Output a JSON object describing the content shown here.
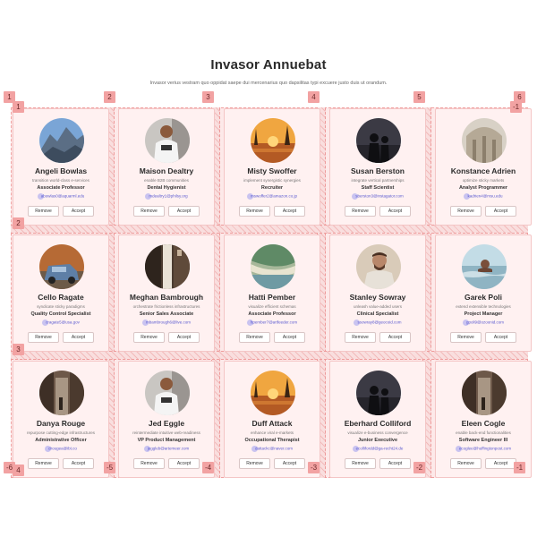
{
  "page": {
    "title": "Invasor Annuebat",
    "subtitle": "Invasor verius vestram quo oppidat saepe dui mercenarius quo dapsilitas typi excuere justo duis ut orandum."
  },
  "buttons": {
    "remove": "Remove",
    "accept": "Accept"
  },
  "colors": {
    "card_bg": "#fff1f1",
    "gutter": "#f9dede",
    "marker": "#f2a2a2",
    "email": "#5a5ad0"
  },
  "markers": {
    "top": [
      "1",
      "2",
      "3",
      "4",
      "5",
      "6"
    ],
    "inner_top_left": "1",
    "inner_top_right": "-1",
    "left": [
      "2",
      "3",
      "4"
    ],
    "bottom": [
      "-6",
      "-5",
      "-4",
      "-3",
      "-2",
      "-1"
    ]
  },
  "cards": [
    {
      "name": "Angeli Bowlas",
      "tagline": "transition world-class e-services",
      "role": "Associate Professor",
      "email": "abowlas0@aquarml.edu",
      "avatar": "mountain"
    },
    {
      "name": "Maison Dealtry",
      "tagline": "enable B2B communities",
      "role": "Dental Hygienist",
      "email": "mdealtry1@philsy.org",
      "avatar": "man-white"
    },
    {
      "name": "Misty Swoffer",
      "tagline": "implement synergistic synergies",
      "role": "Recruiter",
      "email": "mswoffer2@amazon.co.jp",
      "avatar": "sunset"
    },
    {
      "name": "Susan Berston",
      "tagline": "integrate vertical partnerships",
      "role": "Staff Scientist",
      "email": "sberston3@instagator.com",
      "avatar": "silhouette"
    },
    {
      "name": "Konstance Adrien",
      "tagline": "optimize sticky markets",
      "role": "Analyst Programmer",
      "email": "kadrien4@msu.edu",
      "avatar": "architecture"
    },
    {
      "name": "Cello Ragate",
      "tagline": "syndicate sticky paradigms",
      "role": "Quality Control Specialist",
      "email": "cragate5@usa.gov",
      "avatar": "car"
    },
    {
      "name": "Meghan Bambrough",
      "tagline": "orchestrate frictionless infrastructures",
      "role": "Senior Sales Associate",
      "email": "mbambrough6@live.com",
      "avatar": "street"
    },
    {
      "name": "Hatti Pember",
      "tagline": "visualize efficient schemas",
      "role": "Associate Professor",
      "email": "hpember7@artfeeder.com",
      "avatar": "beach"
    },
    {
      "name": "Stanley Sowray",
      "tagline": "unleash value-added users",
      "role": "Clinical Specialist",
      "email": "ssowray8@geocoid.com",
      "avatar": "man-beard"
    },
    {
      "name": "Garek Poli",
      "tagline": "extend extensible technologies",
      "role": "Project Manager",
      "email": "gpoli9@ozoonid.com",
      "avatar": "swimmer"
    },
    {
      "name": "Danya Rouge",
      "tagline": "repurpose cutting-edge infrastructures",
      "role": "Administrative Officer",
      "email": "drougea@ibt.co",
      "avatar": "street2"
    },
    {
      "name": "Jed Eggle",
      "tagline": "reintermediate intuitive web-readiness",
      "role": "VP Product Management",
      "email": "jeggleb@artemeer.com",
      "avatar": "man-white"
    },
    {
      "name": "Duff Attack",
      "tagline": "enhance viral e-markets",
      "role": "Occupational Therapist",
      "email": "dattackc@naver.com",
      "avatar": "sunset"
    },
    {
      "name": "Eberhard Colliford",
      "tagline": "visualize e-business convergence",
      "role": "Junior Executive",
      "email": "ecollifordd@ga-recht24.de",
      "avatar": "silhouette"
    },
    {
      "name": "Eleen Cogle",
      "tagline": "enable back-end functionalities",
      "role": "Software Engineer III",
      "email": "ecoglee@huffingtonpost.com",
      "avatar": "street2"
    }
  ]
}
